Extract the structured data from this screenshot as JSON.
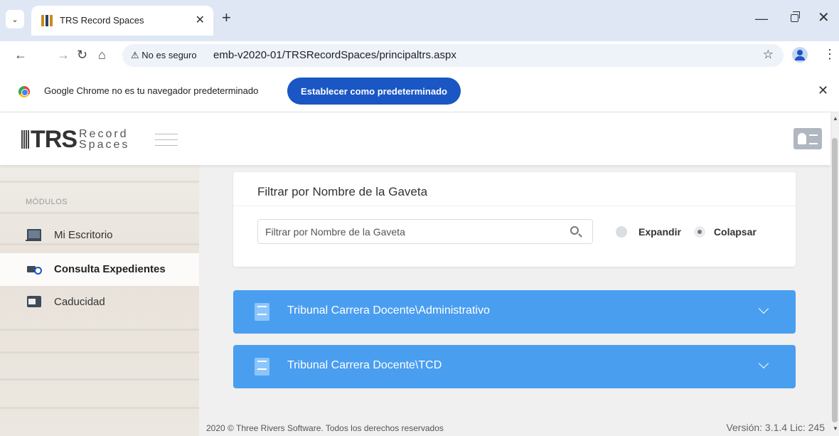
{
  "browser": {
    "tab_title": "TRS Record Spaces",
    "security_label": "⚠ No es seguro",
    "url": "emb-v2020-01/TRSRecordSpaces/principaltrs.aspx",
    "infobar_text": "Google Chrome no es tu navegador predeterminado",
    "infobar_button": "Establecer como predeterminado"
  },
  "app": {
    "logo_main": "TRS",
    "logo_line1": "Record",
    "logo_line2": "Spaces"
  },
  "sidebar": {
    "heading": "MÓDULOS",
    "items": [
      {
        "label": "Mi Escritorio",
        "icon": "laptop-icon"
      },
      {
        "label": "Consulta Expedientes",
        "icon": "truck-search-icon",
        "active": true
      },
      {
        "label": "Caducidad",
        "icon": "calendar-icon"
      }
    ]
  },
  "filter": {
    "title": "Filtrar por Nombre de la Gaveta",
    "placeholder": "Filtrar por Nombre de la Gaveta",
    "value": "",
    "options": [
      {
        "label": "Expandir",
        "checked": false
      },
      {
        "label": "Colapsar",
        "checked": true
      }
    ]
  },
  "drawers": [
    {
      "label": "Tribunal Carrera Docente\\Administrativo"
    },
    {
      "label": "Tribunal Carrera Docente\\TCD"
    }
  ],
  "footer": {
    "copyright": "2020 © Three Rivers Software. Todos los derechos reservados",
    "version": "Versión: 3.1.4  Lic: 245"
  },
  "colors": {
    "drawer_blue": "#4a9ef0",
    "chrome_button_blue": "#1a56c4"
  }
}
